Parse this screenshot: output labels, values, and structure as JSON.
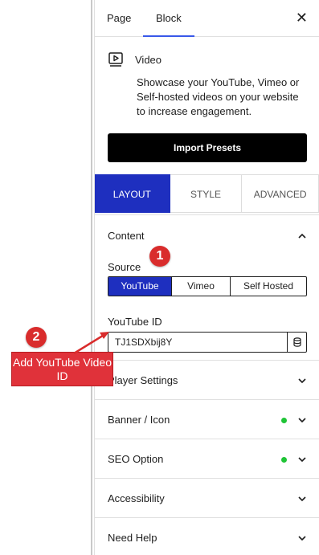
{
  "tabs": {
    "page": "Page",
    "block": "Block",
    "close": "✕"
  },
  "block": {
    "icon": "video-icon",
    "title": "Video",
    "description": "Showcase your YouTube, Vimeo or Self-hosted videos on your website to increase engagement.",
    "import_label": "Import Presets"
  },
  "subtabs": {
    "layout": "LAYOUT",
    "style": "STYLE",
    "advanced": "ADVANCED"
  },
  "content": {
    "title": "Content",
    "source_label": "Source",
    "source_options": [
      "YouTube",
      "Vimeo",
      "Self Hosted"
    ],
    "source_selected": "YouTube",
    "youtube_id_label": "YouTube ID",
    "youtube_id_value": "TJ1SDXbij8Y"
  },
  "sections": [
    {
      "title": "Player Settings",
      "has_dot": false
    },
    {
      "title": "Banner / Icon",
      "has_dot": true
    },
    {
      "title": "SEO Option",
      "has_dot": true
    },
    {
      "title": "Accessibility",
      "has_dot": false
    },
    {
      "title": "Need Help",
      "has_dot": false
    }
  ],
  "annotations": {
    "badge1": "1",
    "badge2": "2",
    "callout": "Add YouTube Video ID"
  },
  "colors": {
    "accent": "#1e2fbf",
    "dot": "#1fc436",
    "annotation": "#e0323a",
    "tab_underline": "#3858e9"
  }
}
